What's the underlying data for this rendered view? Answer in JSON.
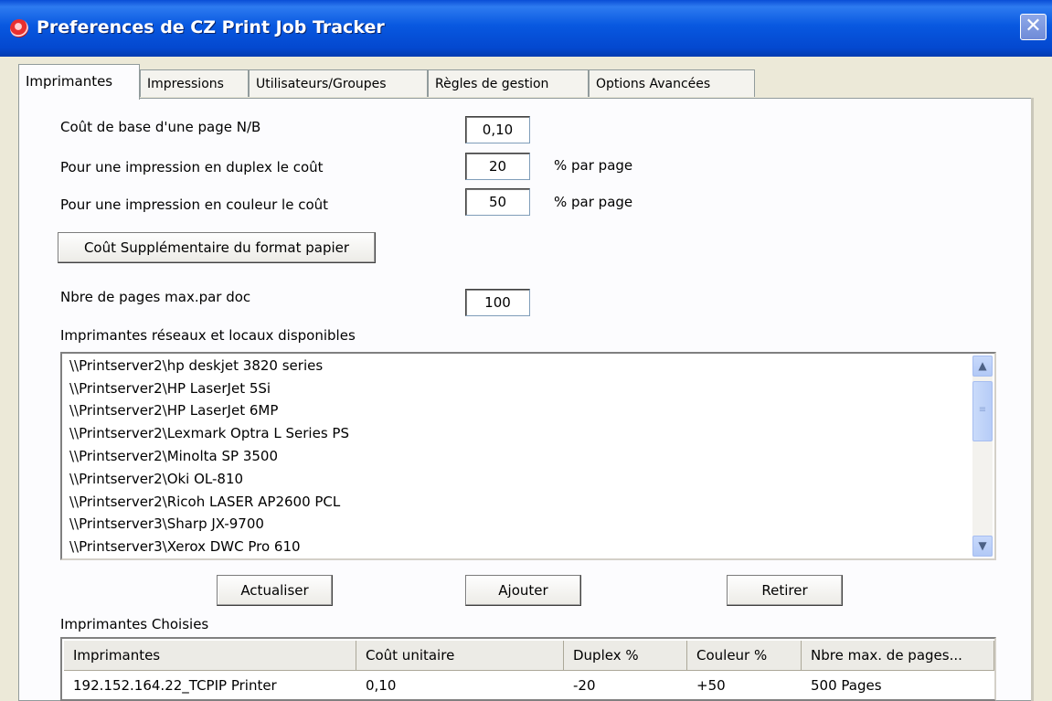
{
  "window": {
    "title": "Preferences de CZ Print Job Tracker",
    "close_glyph": "✕"
  },
  "tabs": [
    {
      "label": "Imprimantes",
      "active": true
    },
    {
      "label": "Impressions",
      "active": false
    },
    {
      "label": "Utilisateurs/Groupes",
      "active": false
    },
    {
      "label": "Règles de gestion",
      "active": false
    },
    {
      "label": "Options Avancées",
      "active": false
    }
  ],
  "form": {
    "base_cost_label": "Coût de base d'une page N/B",
    "base_cost_value": "0,10",
    "duplex_label": "Pour une impression en duplex le coût",
    "duplex_value": "20",
    "duplex_unit": "% par page",
    "color_label": "Pour une impression en couleur le coût",
    "color_value": "50",
    "color_unit": "% par page",
    "paper_format_button": "Coût Supplémentaire du format papier",
    "max_pages_label": "Nbre de pages max.par doc",
    "max_pages_value": "100"
  },
  "available_printers": {
    "label": "Imprimantes réseaux et locaux disponibles",
    "items": [
      "\\\\Printserver2\\hp deskjet 3820 series",
      "\\\\Printserver2\\HP LaserJet 5Si",
      "\\\\Printserver2\\HP LaserJet 6MP",
      "\\\\Printserver2\\Lexmark Optra L Series PS",
      "\\\\Printserver2\\Minolta SP 3500",
      "\\\\Printserver2\\Oki OL-810",
      "\\\\Printserver2\\Ricoh LASER AP2600 PCL",
      "\\\\Printserver3\\Sharp JX-9700",
      "\\\\Printserver3\\Xerox DWC Pro 610"
    ]
  },
  "actions": {
    "refresh": "Actualiser",
    "add": "Ajouter",
    "remove": "Retirer"
  },
  "chosen_printers": {
    "label": "Imprimantes Choisies",
    "columns": [
      "Imprimantes",
      "Coût unitaire",
      "Duplex %",
      "Couleur %",
      "Nbre max. de pages..."
    ],
    "rows": [
      [
        "192.152.164.22_TCPIP Printer",
        "0,10",
        "-20",
        "+50",
        "500 Pages"
      ]
    ]
  },
  "scrollbar": {
    "up_glyph": "▲",
    "down_glyph": "▼",
    "thumb_glyph": "≡"
  },
  "colors": {
    "titlebar": "#0858e0",
    "window_bg": "#ece9d8",
    "panel_bg": "#fcfcfe"
  }
}
